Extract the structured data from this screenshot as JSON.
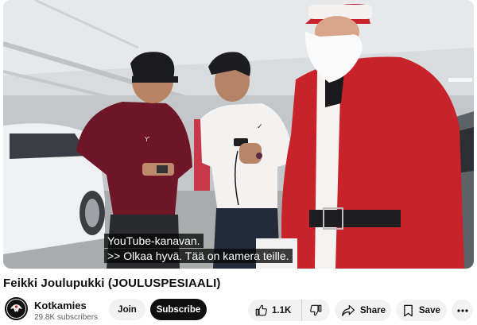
{
  "player": {
    "captions": {
      "line1": "YouTube-kanavan.",
      "line2": ">> Olkaa hyvä. Tää on kamera teille."
    }
  },
  "video": {
    "title": "Feikki Joulupukki (JOULUSPESIAALI)"
  },
  "channel": {
    "name": "Kotkamies",
    "subscribers": "29.8K subscribers",
    "avatar_icon": "eagle-logo-icon"
  },
  "actions": {
    "join_label": "Join",
    "subscribe_label": "Subscribe",
    "like_count": "1.1K",
    "share_label": "Share",
    "save_label": "Save",
    "icons": {
      "like": "thumbs-up-icon",
      "dislike": "thumbs-down-icon",
      "share": "share-arrow-icon",
      "save": "bookmark-icon",
      "more": "more-horizontal-icon"
    }
  },
  "colors": {
    "subscribe_bg": "#0f0f0f",
    "pill_bg": "#f2f2f2",
    "subtext": "#606060",
    "santa_red": "#c8222b"
  }
}
